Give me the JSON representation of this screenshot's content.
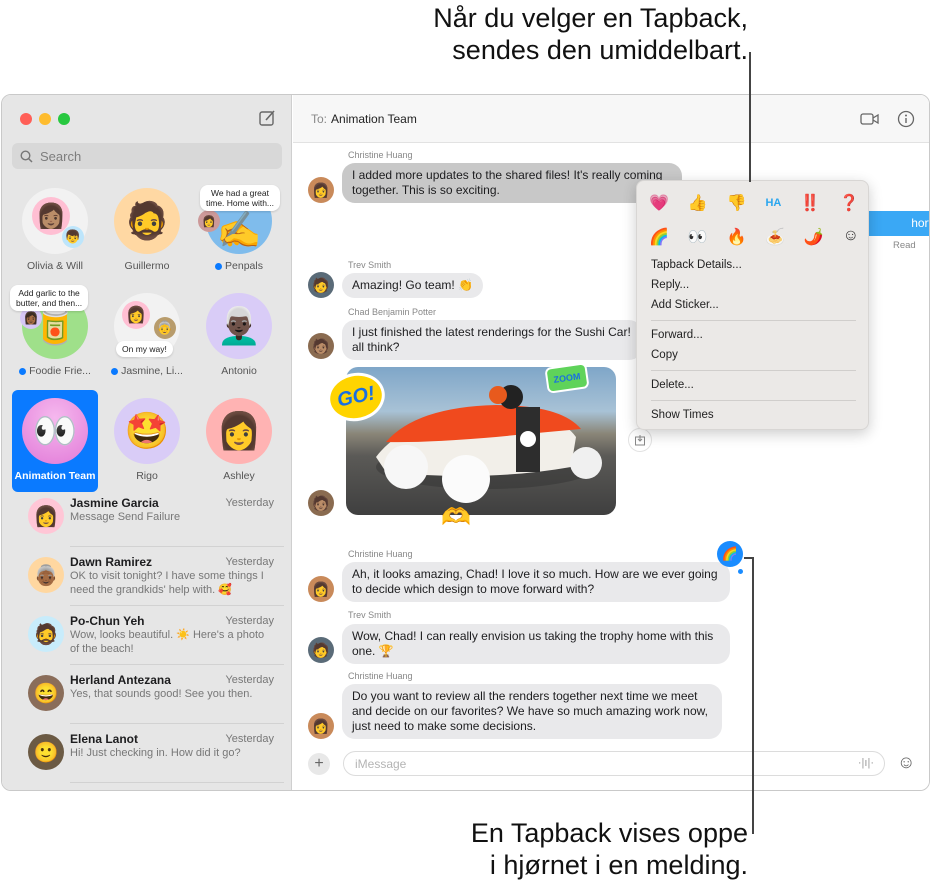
{
  "callouts": {
    "top": [
      "Når du velger en Tapback,",
      "sendes den umiddelbart."
    ],
    "bottom": [
      "En Tapback vises oppe",
      "i hjørnet i en melding."
    ]
  },
  "window": {
    "traffic_colors": [
      "#ff5f57",
      "#febc2e",
      "#28c840"
    ],
    "accent": "#0a7aff"
  },
  "sidebar": {
    "search_placeholder": "Search",
    "pinned": [
      {
        "label": "Olivia & Will",
        "unread": false,
        "emoji": "👩",
        "bg": "#f2f2f2"
      },
      {
        "label": "Guillermo",
        "unread": false,
        "emoji": "🧔",
        "bg": "#ffd8a3"
      },
      {
        "label": "Penpals",
        "unread": true,
        "emoji": "✍️",
        "bg": "#7fbcec",
        "tip": [
          "We had a great",
          "time. Home with..."
        ]
      },
      {
        "label": "Foodie Frie...",
        "unread": true,
        "emoji": "🥫",
        "bg": "#9fe08a",
        "tip": [
          "Add garlic to the",
          "butter, and then..."
        ]
      },
      {
        "label": "Jasmine, Li...",
        "unread": true,
        "emoji": "👩",
        "bg": "#f2f2f2",
        "tip": [
          "On my way!"
        ]
      },
      {
        "label": "Antonio",
        "unread": false,
        "emoji": "👨🏿‍🦳",
        "bg": "#d9ccf7"
      },
      {
        "label": "Animation Team",
        "unread": false,
        "emoji": "👀",
        "bg": "#f0a6e6",
        "selected": true
      },
      {
        "label": "Rigo",
        "unread": false,
        "emoji": "🤩",
        "bg": "#d9ccf7"
      },
      {
        "label": "Ashley",
        "unread": false,
        "emoji": "👩",
        "bg": "#ffb3b3"
      }
    ],
    "conversations": [
      {
        "name": "Jasmine Garcia",
        "time": "Yesterday",
        "preview": "Message Send Failure",
        "emoji": "👩",
        "bg": "#ffc6d6"
      },
      {
        "name": "Dawn Ramirez",
        "time": "Yesterday",
        "preview": "OK to visit tonight? I have some things I need the grandkids' help with. 🥰",
        "emoji": "👵🏾",
        "bg": "#ffd7a0"
      },
      {
        "name": "Po-Chun Yeh",
        "time": "Yesterday",
        "preview": "Wow, looks beautiful. ☀️ Here's a photo of the beach!",
        "emoji": "🧔",
        "bg": "#c8ecfb"
      },
      {
        "name": "Herland Antezana",
        "time": "Yesterday",
        "preview": "Yes, that sounds good! See you then.",
        "emoji": "😄",
        "bg": "#8a6d5a"
      },
      {
        "name": "Elena Lanot",
        "time": "Yesterday",
        "preview": "Hi! Just checking in. How did it go?",
        "emoji": "🙂",
        "bg": "#6b5a44"
      }
    ]
  },
  "header": {
    "to_label": "To:",
    "recipient": "Animation Team"
  },
  "messages": [
    {
      "sender": "Christine Huang",
      "text": "I added more updates to the shared files! It's really coming together. This is so exciting."
    },
    {
      "outgoing_partial": "hortly.",
      "status": "Read"
    },
    {
      "sender": "Trev Smith",
      "text": "Amazing! Go team! 👏"
    },
    {
      "sender": "Chad Benjamin Potter",
      "text": "I just finished the latest renderings for the Sushi Car! all think?"
    },
    {
      "sender": "Christine Huang",
      "text": "Ah, it looks amazing, Chad! I love it so much. How are we ever going to decide which design to move forward with?",
      "tapback": "🌈"
    },
    {
      "sender": "Trev Smith",
      "text": "Wow, Chad! I can really envision us taking the trophy home with this one. 🏆"
    },
    {
      "sender": "Christine Huang",
      "text": "Do you want to review all the renders together next time we meet and decide on our favorites? We have so much amazing work now, just need to make some decisions."
    }
  ],
  "image_stickers": [
    "GO!",
    "ZOOM",
    "🫶"
  ],
  "context_menu": {
    "tapbacks_row1": [
      "💗",
      "👍",
      "👎",
      "HA",
      "‼️",
      "❓"
    ],
    "tapbacks_row2": [
      "🌈",
      "👀",
      "🔥",
      "🍝",
      "🌶️",
      "☺"
    ],
    "items": [
      "Tapback Details...",
      "Reply...",
      "Add Sticker...",
      "Forward...",
      "Copy",
      "Delete...",
      "Show Times"
    ]
  },
  "compose": {
    "placeholder": "iMessage"
  }
}
